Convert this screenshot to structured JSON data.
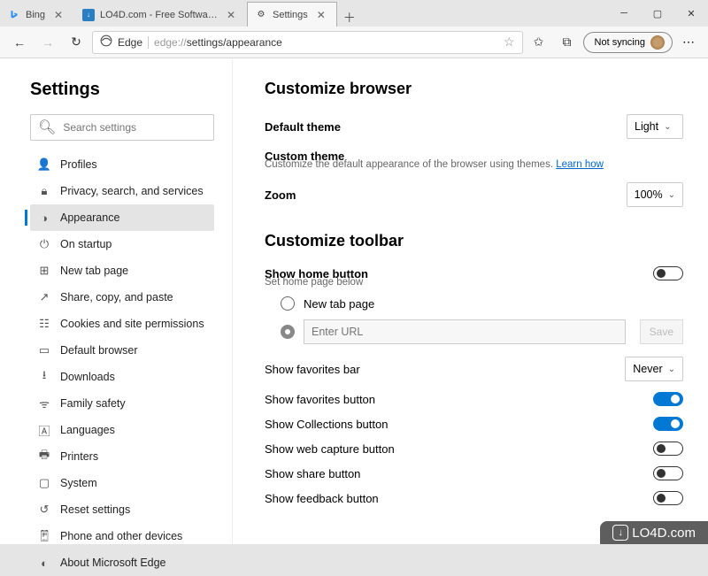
{
  "window": {
    "tabs": [
      {
        "label": "Bing",
        "favicon_type": "bing"
      },
      {
        "label": "LO4D.com - Free Software Dow…",
        "favicon_type": "lo4d"
      },
      {
        "label": "Settings",
        "favicon_type": "gear"
      }
    ],
    "active_tab": 2,
    "sync_label": "Not syncing"
  },
  "toolbar": {
    "site_label": "Edge",
    "url_scheme": "edge://",
    "url_path": "settings/appearance"
  },
  "sidebar": {
    "title": "Settings",
    "search_placeholder": "Search settings",
    "items": [
      {
        "icon": "profile",
        "label": "Profiles"
      },
      {
        "icon": "lock",
        "label": "Privacy, search, and services"
      },
      {
        "icon": "appearance",
        "label": "Appearance"
      },
      {
        "icon": "power",
        "label": "On startup"
      },
      {
        "icon": "newtab",
        "label": "New tab page"
      },
      {
        "icon": "share",
        "label": "Share, copy, and paste"
      },
      {
        "icon": "cookies",
        "label": "Cookies and site permissions"
      },
      {
        "icon": "browser",
        "label": "Default browser"
      },
      {
        "icon": "download",
        "label": "Downloads"
      },
      {
        "icon": "family",
        "label": "Family safety"
      },
      {
        "icon": "lang",
        "label": "Languages"
      },
      {
        "icon": "printer",
        "label": "Printers"
      },
      {
        "icon": "system",
        "label": "System"
      },
      {
        "icon": "reset",
        "label": "Reset settings"
      },
      {
        "icon": "phone",
        "label": "Phone and other devices"
      },
      {
        "icon": "edge",
        "label": "About Microsoft Edge"
      }
    ],
    "active_index": 2
  },
  "main": {
    "section1_title": "Customize browser",
    "default_theme_label": "Default theme",
    "default_theme_value": "Light",
    "custom_theme_label": "Custom theme",
    "custom_theme_desc": "Customize the default appearance of the browser using themes. ",
    "custom_theme_link": "Learn how",
    "zoom_label": "Zoom",
    "zoom_value": "100%",
    "section2_title": "Customize toolbar",
    "home_label": "Show home button",
    "home_sub": "Set home page below",
    "radio_newtab": "New tab page",
    "url_placeholder": "Enter URL",
    "save_label": "Save",
    "favbar_label": "Show favorites bar",
    "favbar_value": "Never",
    "rows": [
      {
        "label": "Show favorites button",
        "on": true
      },
      {
        "label": "Show Collections button",
        "on": true
      },
      {
        "label": "Show web capture button",
        "on": false
      },
      {
        "label": "Show share button",
        "on": false
      },
      {
        "label": "Show feedback button",
        "on": false
      }
    ]
  },
  "watermark": "LO4D.com"
}
